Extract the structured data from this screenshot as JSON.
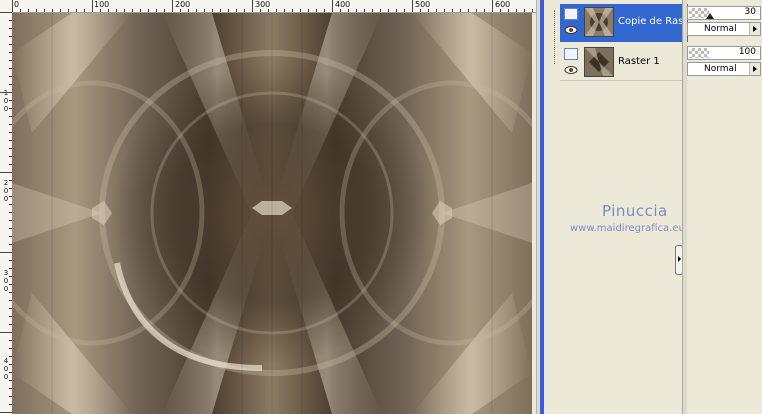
{
  "ruler": {
    "top_labels": [
      "0",
      "100",
      "200",
      "300",
      "400",
      "500",
      "600"
    ],
    "left_labels": [
      "1",
      "0",
      "0",
      "2",
      "0",
      "0",
      "3",
      "0",
      "0",
      "4",
      "0",
      "0"
    ]
  },
  "layers": [
    {
      "name": "Copie de Ras",
      "selected": true,
      "visible": true
    },
    {
      "name": "Raster 1",
      "selected": false,
      "visible": true
    }
  ],
  "properties": [
    {
      "opacity": "30",
      "blend": "Normal"
    },
    {
      "opacity": "100",
      "blend": "Normal"
    }
  ],
  "watermark": {
    "name": "Pinuccia",
    "url": "www.maidiregrafica.eu"
  },
  "colors": {
    "selection": "#3167ce",
    "panel_bg": "#ece9d8",
    "panel_strip": "#3c5bd9",
    "watermark": "#7a8cc6"
  }
}
